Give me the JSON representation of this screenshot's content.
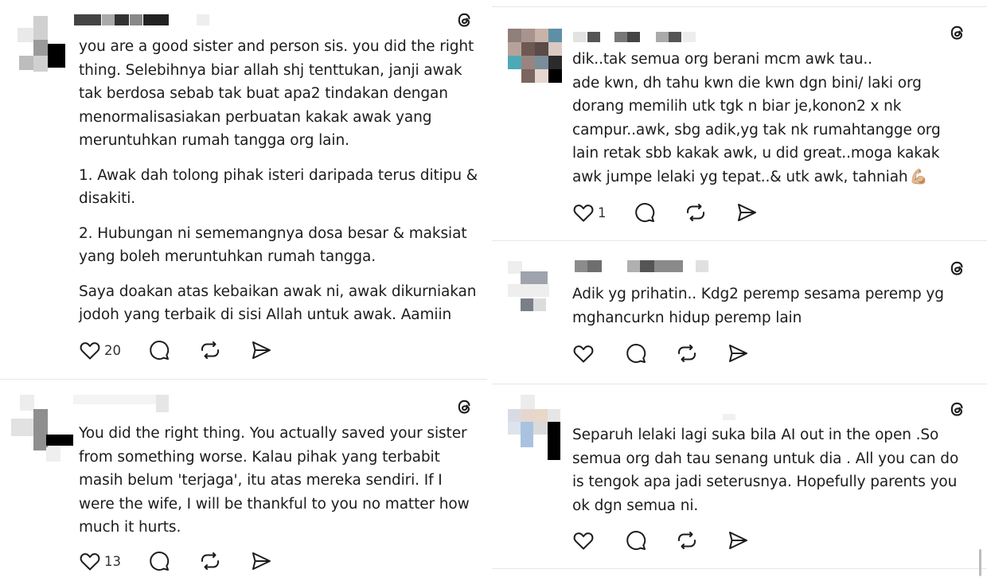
{
  "posts": [
    {
      "paragraphs": [
        "you are a good sister and person sis. you did the right thing. Selebihnya biar allah shj tenttukan, janji awak tak berdosa sebab tak buat apa2 tindakan dengan menormalisasiakan perbuatan kakak awak yang meruntuhkan rumah tangga org lain.",
        "1. Awak dah tolong pihak isteri daripada terus ditipu & disakiti.",
        "2.  Hubungan ni sememangnya dosa besar & maksiat yang boleh meruntuhkan rumah tangga.",
        "Saya doakan atas kebaikan awak ni, awak dikurniakan jodoh yang terbaik di sisi Allah untuk awak. Aamiin"
      ],
      "like_count": "20"
    },
    {
      "paragraphs": [
        "You did the right thing. You actually saved your sister from something worse. Kalau pihak yang terbabit masih belum 'terjaga', itu atas mereka sendiri. If I were the wife, I will be thankful to you no matter how much it hurts."
      ],
      "like_count": "13"
    },
    {
      "paragraphs": [
        "dik..tak semua org berani mcm awk tau..",
        "ade kwn, dh tahu kwn die kwn dgn bini/ laki org dorang memilih utk tgk n biar je,konon2 x nk campur..awk, sbg adik,yg tak nk rumahtangge org lain retak sbb kakak awk, u did great..moga kakak awk jumpe lelaki yg tepat..& utk awk, tahniah"
      ],
      "emoji": "💪🏼",
      "like_count": "1"
    },
    {
      "paragraphs": [
        "Adik yg prihatin.. Kdg2 peremp sesama peremp yg mghancurkn hidup peremp lain"
      ],
      "like_count": ""
    },
    {
      "paragraphs": [
        "Separuh lelaki lagi suka bila AI out in the open .So semua org dah tau senang untuk dia . All you can do is tengok apa jadi seterusnya. Hopefully parents you ok dgn semua ni."
      ],
      "like_count": ""
    }
  ],
  "icons": {
    "app": "threads-icon",
    "like": "heart-icon",
    "reply": "comment-icon",
    "repost": "repost-icon",
    "share": "send-icon"
  },
  "colors": {
    "text": "#1c1c1c",
    "icon": "#1c1c1c",
    "divider": "#e6e6e6"
  }
}
